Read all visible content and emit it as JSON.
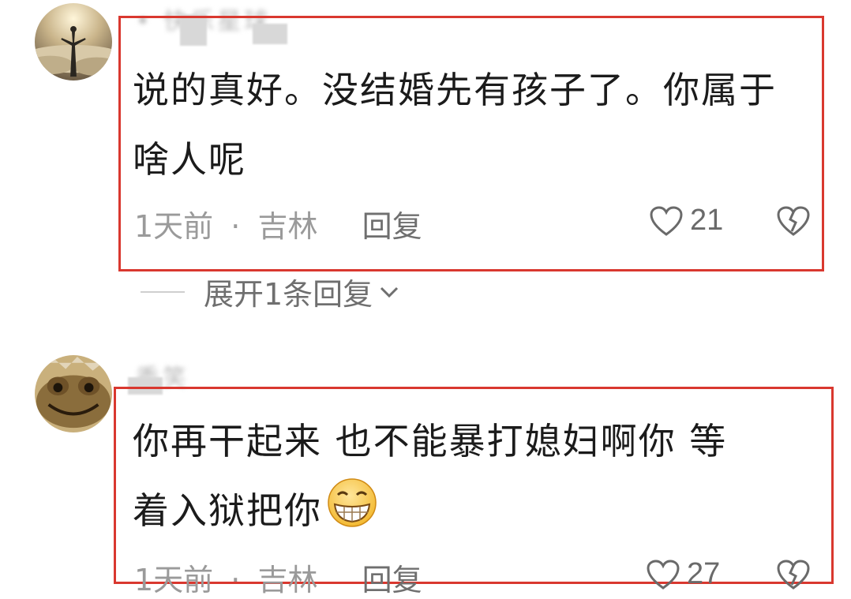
{
  "comments": [
    {
      "username": "• 快乐星球",
      "text_line1": "说的真好。没结婚先有孩子了。你属于",
      "text_line2": "啥人呢",
      "time": "1天前",
      "separator": "·",
      "location": "吉林",
      "reply_label": "回复",
      "likes": "21",
      "expand_label": "展开1条回复"
    },
    {
      "username": "秀笑",
      "text_line1": "你再干起来 也不能暴打媳妇啊你 等",
      "text_line2": "着入狱把你",
      "time": "1天前",
      "separator": "·",
      "location": "吉林",
      "reply_label": "回复",
      "likes": "27"
    }
  ],
  "colors": {
    "highlight_border": "#d9382f",
    "meta_text": "#9a9a9a",
    "body_text": "#1b1b1b"
  },
  "icons": [
    "heart-icon",
    "broken-heart-icon",
    "chevron-down-icon",
    "grin-emoji-icon"
  ]
}
